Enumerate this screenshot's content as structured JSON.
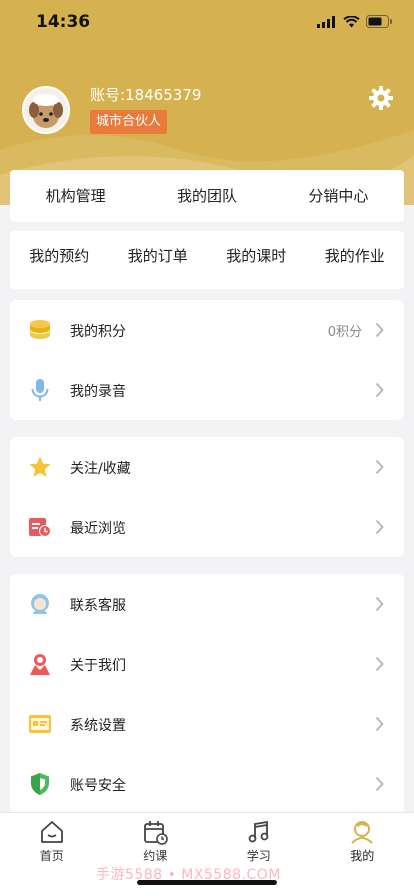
{
  "status_bar": {
    "time": "14:36"
  },
  "colors": {
    "header_bg": "#d6b14f",
    "badge_bg": "#e97a3b",
    "accent": "#d6b14f"
  },
  "profile": {
    "account": "账号:18465379",
    "role_badge": "城市合伙人"
  },
  "top_nav": [
    "机构管理",
    "我的团队",
    "分销中心"
  ],
  "quick_nav": [
    "我的预约",
    "我的订单",
    "我的课时",
    "我的作业"
  ],
  "section1": [
    {
      "label": "我的积分",
      "value": "0积分",
      "icon": "coins-icon"
    },
    {
      "label": "我的录音",
      "icon": "microphone-icon"
    }
  ],
  "section2": [
    {
      "label": "关注/收藏",
      "icon": "star-icon"
    },
    {
      "label": "最近浏览",
      "icon": "history-icon"
    }
  ],
  "section3": [
    {
      "label": "联系客服",
      "icon": "customer-service-icon"
    },
    {
      "label": "关于我们",
      "icon": "about-us-icon"
    },
    {
      "label": "系统设置",
      "icon": "system-settings-icon"
    },
    {
      "label": "账号安全",
      "icon": "shield-icon"
    }
  ],
  "tabbar": [
    {
      "label": "首页",
      "icon": "home-icon"
    },
    {
      "label": "约课",
      "icon": "calendar-icon"
    },
    {
      "label": "学习",
      "icon": "music-note-icon"
    },
    {
      "label": "我的",
      "icon": "profile-icon",
      "active": true
    }
  ],
  "watermark": "手游5588 • MX5588.COM"
}
